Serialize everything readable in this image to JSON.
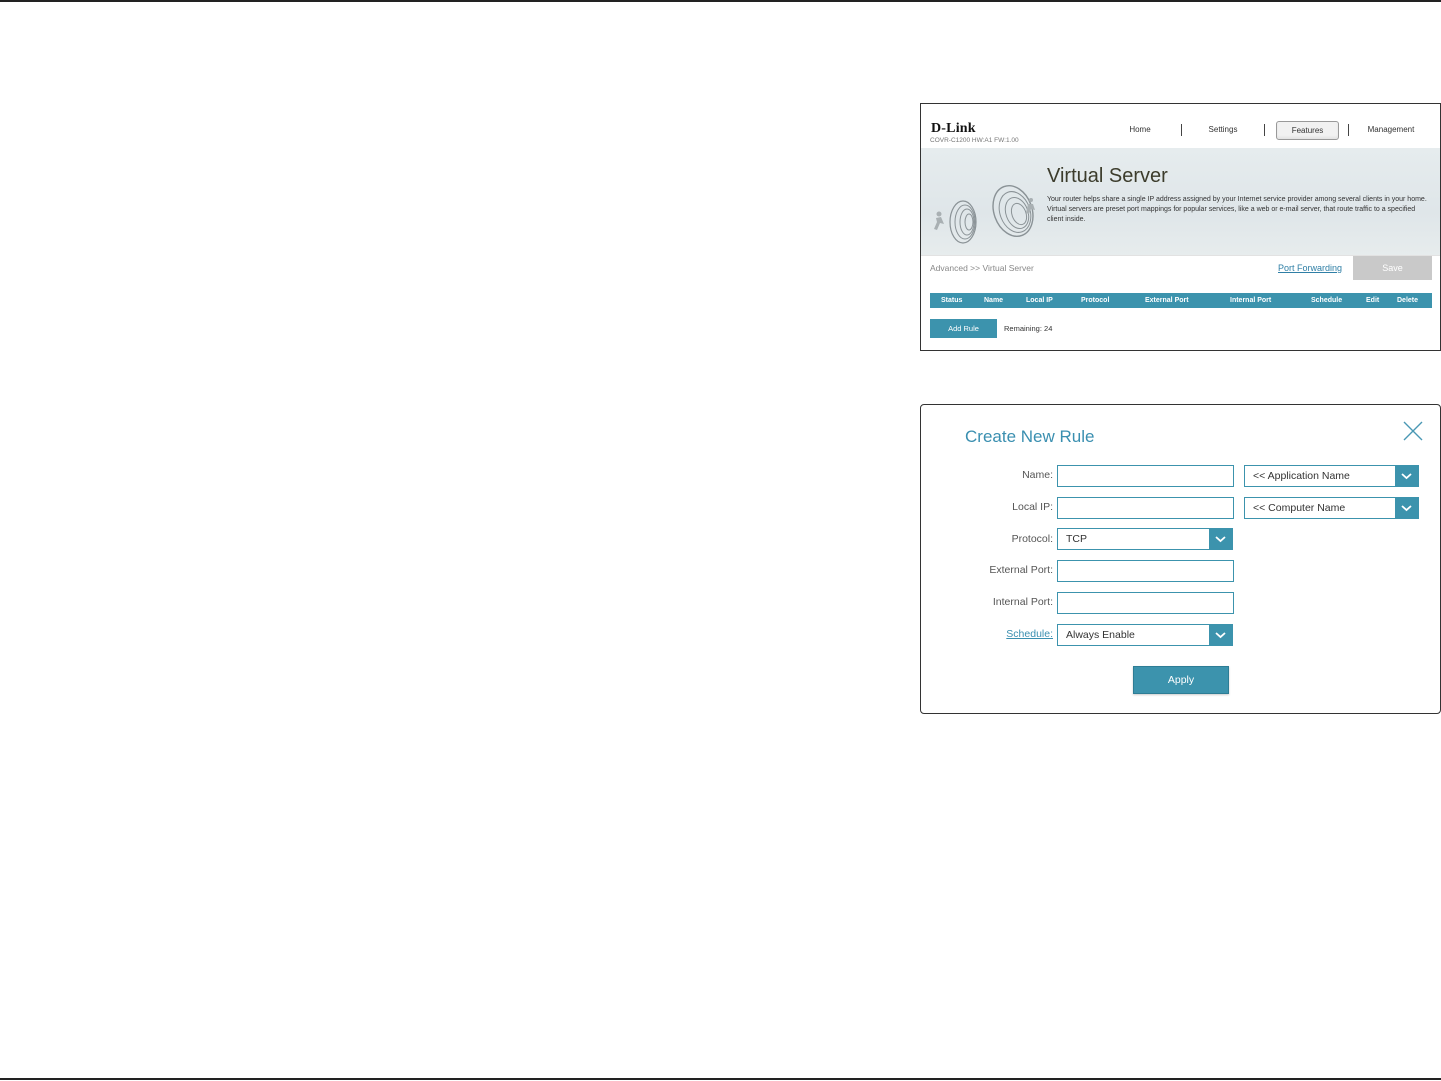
{
  "virtual_server": {
    "header": {
      "logo": "D-Link",
      "model": "COVR-C1200 HW:A1 FW:1.00",
      "nav": [
        "Home",
        "Settings",
        "Features",
        "Management"
      ],
      "active_nav": "Features"
    },
    "banner": {
      "title": "Virtual Server",
      "description": "Your router helps share a single IP address assigned by your Internet service provider among several clients in your home. Virtual servers are preset port mappings for popular services, like a web or e-mail server, that route traffic to a specified client inside."
    },
    "breadcrumb": "Advanced >> Virtual Server",
    "port_forwarding_link": "Port Forwarding",
    "save_label": "Save",
    "table_headers": [
      "Status",
      "Name",
      "Local IP",
      "Protocol",
      "External Port",
      "Internal Port",
      "Schedule",
      "Edit",
      "Delete"
    ],
    "add_rule_label": "Add Rule",
    "remaining": "Remaining: 24"
  },
  "create_rule": {
    "title": "Create New Rule",
    "labels": {
      "name": "Name:",
      "local_ip": "Local IP:",
      "protocol": "Protocol:",
      "external_port": "External Port:",
      "internal_port": "Internal Port:",
      "schedule": "Schedule:"
    },
    "values": {
      "name": "",
      "local_ip": "",
      "external_port": "",
      "internal_port": ""
    },
    "application_select": "<< Application Name",
    "computer_select": "<< Computer Name",
    "protocol_select": "TCP",
    "schedule_select": "Always Enable",
    "apply_label": "Apply"
  },
  "colors": {
    "accent": "#3c93ad",
    "save_disabled": "#c9c9c9",
    "title_blue": "#3a8fb0"
  }
}
